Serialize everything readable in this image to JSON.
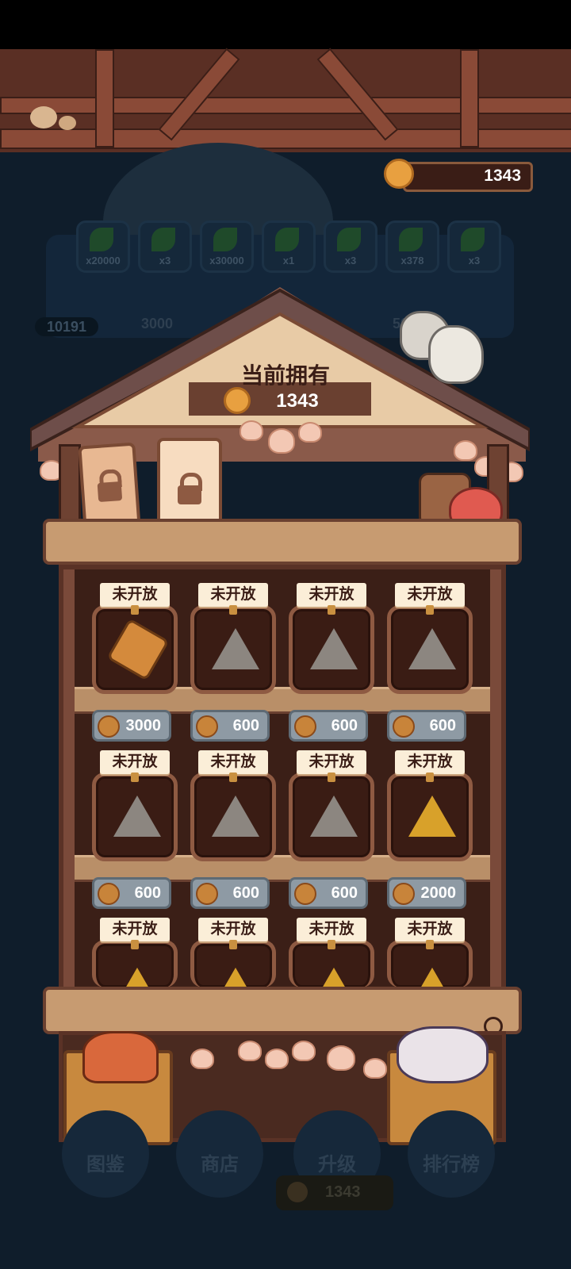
{
  "hud": {
    "coin_balance": "1343"
  },
  "background_panel": {
    "rewards": [
      {
        "label": "x20000"
      },
      {
        "label": "x3"
      },
      {
        "label": "x30000"
      },
      {
        "label": "x1"
      },
      {
        "label": "x3"
      },
      {
        "label": "x378"
      },
      {
        "label": "x3"
      }
    ],
    "player_score": "10191",
    "milestones": [
      "3000",
      "5000"
    ]
  },
  "shop": {
    "title": "当前拥有",
    "owned_coins": "1343",
    "items": [
      {
        "status": "未开放",
        "price": "3000",
        "icon": "slingshot-icon"
      },
      {
        "status": "未开放",
        "price": "600",
        "icon": "triangle-stone-icon"
      },
      {
        "status": "未开放",
        "price": "600",
        "icon": "leaf-stone-icon"
      },
      {
        "status": "未开放",
        "price": "600",
        "icon": "crab-stone-icon"
      },
      {
        "status": "未开放",
        "price": "600",
        "icon": "swirl-stone-icon"
      },
      {
        "status": "未开放",
        "price": "600",
        "icon": "flower-stone-icon"
      },
      {
        "status": "未开放",
        "price": "600",
        "icon": "shell-stone-icon"
      },
      {
        "status": "未开放",
        "price": "2000",
        "icon": "starfish-gold-icon"
      },
      {
        "status": "未开放",
        "icon": "gold-stone-icon"
      },
      {
        "status": "未开放",
        "icon": "gold-stone-icon"
      },
      {
        "status": "未开放",
        "icon": "gold-stone-icon"
      },
      {
        "status": "未开放",
        "icon": "gold-stone-icon"
      }
    ]
  },
  "bottom_nav": {
    "items": [
      "图鉴",
      "商店",
      "升级",
      "排行榜"
    ],
    "coin_display": "1343"
  },
  "colors": {
    "wood_dark": "#5a3226",
    "wood_light": "#c79b71",
    "tag_paper": "#fbeed8",
    "price_grey": "#8e9aa4",
    "night_bg": "#0f1d2b"
  }
}
